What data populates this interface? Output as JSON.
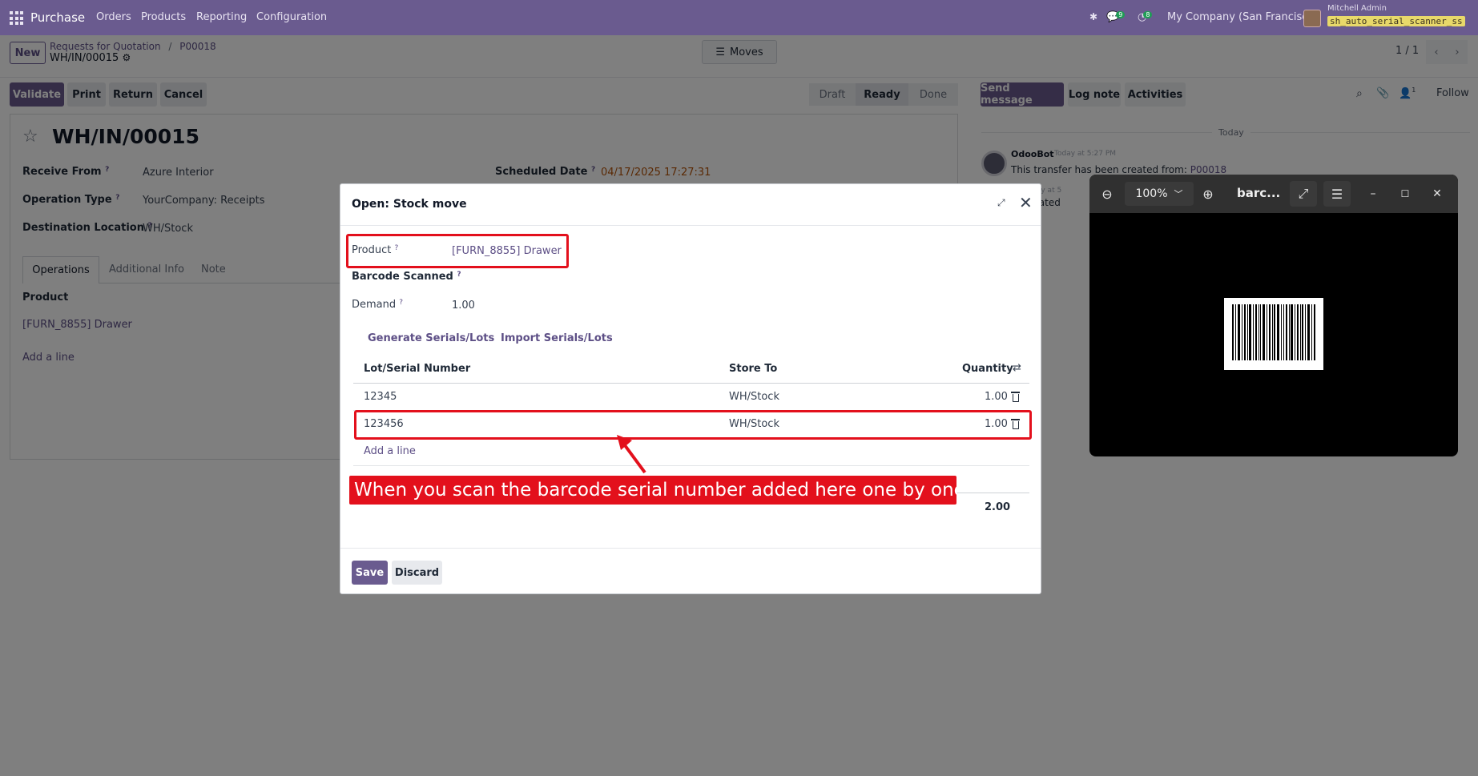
{
  "navbar": {
    "app_name": "Purchase",
    "menu": [
      "Orders",
      "Products",
      "Reporting",
      "Configuration"
    ],
    "chat_count": "9",
    "activity_count": "8",
    "company": "My Company (San Francisco)",
    "user_name": "Mitchell Admin",
    "database": "sh_auto_serial_scanner_ss"
  },
  "control": {
    "new_label": "New",
    "breadcrumb_parent": "Requests for Quotation",
    "breadcrumb_sep": "/",
    "breadcrumb_po": "P00018",
    "breadcrumb_current": "WH/IN/00015",
    "moves_label": "Moves",
    "pager": "1 / 1"
  },
  "actions": {
    "validate": "Validate",
    "print": "Print",
    "return": "Return",
    "cancel": "Cancel"
  },
  "statusbar": [
    "Draft",
    "Ready",
    "Done"
  ],
  "form": {
    "title": "WH/IN/00015",
    "receive_from_label": "Receive From",
    "receive_from": "Azure Interior",
    "operation_type_label": "Operation Type",
    "operation_type": "YourCompany: Receipts",
    "destination_label": "Destination Location",
    "destination": "WH/Stock",
    "scheduled_date_label": "Scheduled Date",
    "scheduled_date": "04/17/2025 17:27:31",
    "help_mark": "?",
    "tabs": [
      "Operations",
      "Additional Info",
      "Note"
    ],
    "product_col": "Product",
    "product_line": "[FURN_8855] Drawer",
    "add_line": "Add a line"
  },
  "chatter": {
    "send_message": "Send message",
    "log_note": "Log note",
    "activities": "Activities",
    "followers": "1",
    "follow": "Follow",
    "day": "Today",
    "author": "OdooBot",
    "time": "Today at 5:27 PM",
    "message_prefix": "This transfer has been created from:",
    "message_link": "P00018",
    "author2_tail": "ot",
    "time2": "Today at 5",
    "message2_tail": "er created"
  },
  "modal": {
    "title": "Open: Stock move",
    "product_label": "Product",
    "product_value": "[FURN_8855] Drawer",
    "barcode_label": "Barcode Scanned",
    "demand_label": "Demand",
    "demand_value": "1.00",
    "generate_btn": "Generate Serials/Lots",
    "import_btn": "Import Serials/Lots",
    "columns": {
      "lot": "Lot/Serial Number",
      "store": "Store To",
      "qty": "Quantity"
    },
    "rows": [
      {
        "lot": "12345",
        "store": "WH/Stock",
        "qty": "1.00"
      },
      {
        "lot": "123456",
        "store": "WH/Stock",
        "qty": "1.00"
      }
    ],
    "add_line": "Add a line",
    "total": "2.00",
    "save": "Save",
    "discard": "Discard"
  },
  "annotation": {
    "text": "When you scan the barcode serial number added here one by one",
    "color": "#e3101c"
  },
  "viewer": {
    "zoom": "100%",
    "title": "barc..."
  },
  "colors": {
    "brand": "#6a5b8f",
    "link": "#5d4f86",
    "annotation_red": "#e3101c"
  }
}
